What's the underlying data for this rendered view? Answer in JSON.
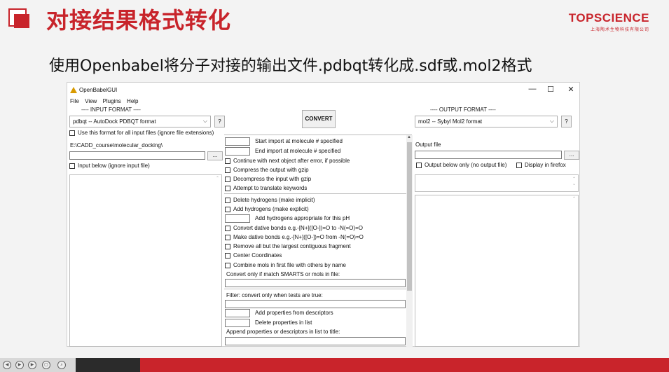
{
  "slide": {
    "title": "对接结果格式转化",
    "subtitle": "使用Openbabel将分子对接的输出文件.pdbqt转化成.sdf或.mol2格式",
    "logo_brand": "TOPSCIENCE",
    "logo_sub": "上海陶术生物科技有限公司",
    "accent_color": "#c8242b"
  },
  "window": {
    "title": "OpenBabelGUI",
    "controls": {
      "minimize": "—",
      "maximize": "☐",
      "close": "✕"
    },
    "menu": [
      "File",
      "View",
      "Plugins",
      "Help"
    ]
  },
  "input": {
    "group_label": "---- INPUT FORMAT ----",
    "format": "pdbqt -- AutoDock PDBQT format",
    "help": "?",
    "use_for_all": "Use this format for all input files (ignore file extensions)",
    "path": "E:\\CADD_course\\molecular_docking\\",
    "browse": "...",
    "input_below": "Input below (ignore input file)"
  },
  "convert": {
    "label": "CONVERT"
  },
  "options": {
    "start_import": "Start import at molecule # specified",
    "end_import": "End import at molecule # specified",
    "continue_next": "Continue with next object after error, if possible",
    "compress": "Compress the output with gzip",
    "decompress": "Decompress the input with gzip",
    "translate": "Attempt to translate keywords",
    "delete_h": "Delete hydrogens (make implicit)",
    "add_h": "Add hydrogens (make explicit)",
    "add_h_ph": "Add hydrogens appropriate for this pH",
    "dative1": "Convert dative bonds e.g.-[N+]([O-])=O to -N(=O)=O",
    "dative2": "Make dative bonds e.g.-[N+]([O-])=O from -N(=O)=O",
    "remove_all": "Remove all but the largest contiguous fragment",
    "center": "Center Coordinates",
    "combine": "Combine mols in first file with others by name",
    "smarts": "Convert only if match SMARTS or mols in file:",
    "filter": "Filter: convert only when tests are true:",
    "add_props": "Add properties from descriptors",
    "del_props": "Delete properties in list",
    "append": "Append properties or descriptors in list to title:"
  },
  "output": {
    "group_label": "---- OUTPUT FORMAT ----",
    "format": "mol2 -- Sybyl Mol2 format",
    "help": "?",
    "file_label": "Output file",
    "browse": "...",
    "output_below": "Output below only (no output file)",
    "display_firefox": "Display in firefox"
  }
}
